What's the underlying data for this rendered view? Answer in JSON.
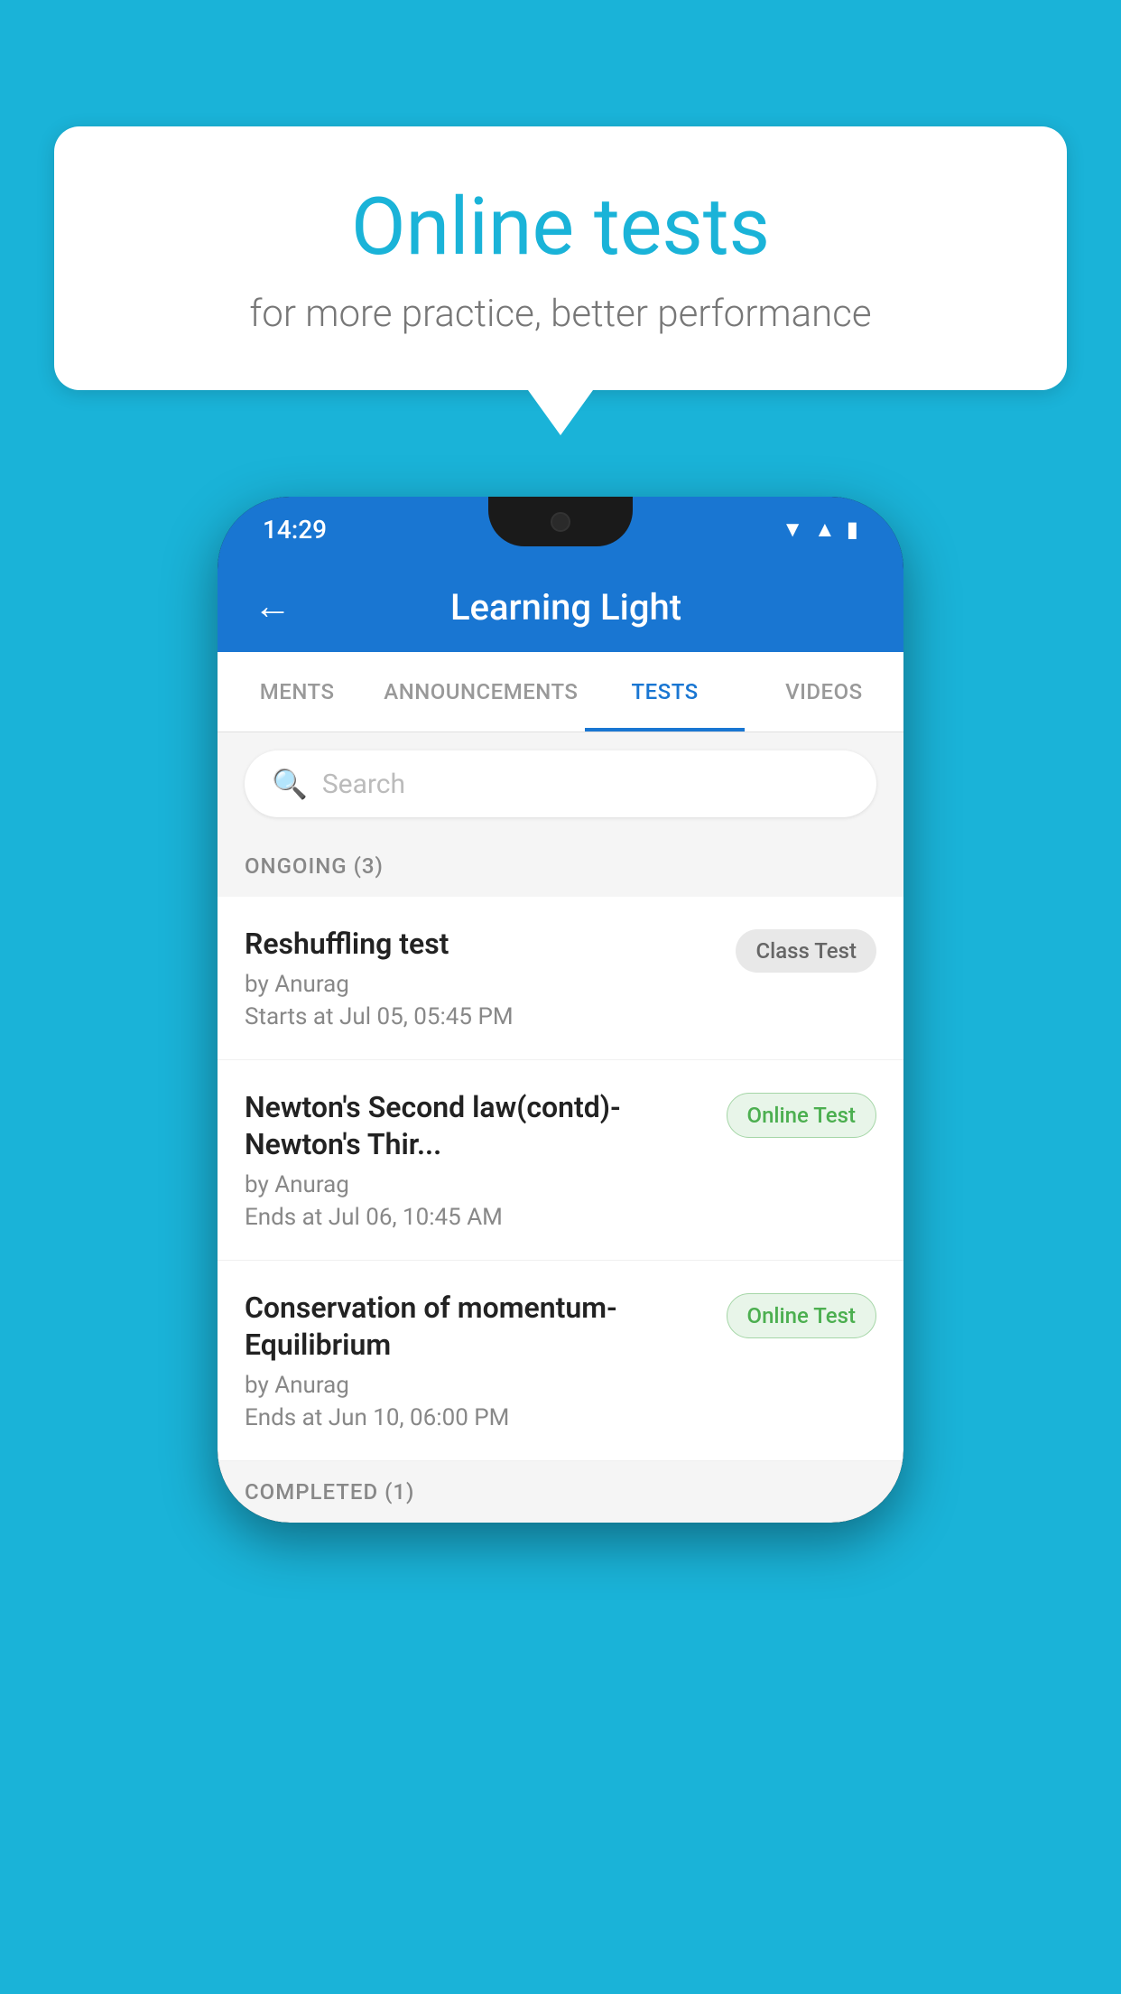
{
  "background": {
    "color": "#1ab3d8"
  },
  "speech_bubble": {
    "title": "Online tests",
    "subtitle": "for more practice, better performance"
  },
  "status_bar": {
    "time": "14:29",
    "icons": [
      "wifi",
      "signal",
      "battery"
    ]
  },
  "app_header": {
    "back_label": "←",
    "title": "Learning Light"
  },
  "tabs": [
    {
      "label": "MENTS",
      "active": false
    },
    {
      "label": "ANNOUNCEMENTS",
      "active": false
    },
    {
      "label": "TESTS",
      "active": true
    },
    {
      "label": "VIDEOS",
      "active": false
    }
  ],
  "search": {
    "placeholder": "Search"
  },
  "ongoing_section": {
    "label": "ONGOING (3)"
  },
  "tests": [
    {
      "name": "Reshuffling test",
      "author": "by Anurag",
      "time_label": "Starts at",
      "time_value": "Jul 05, 05:45 PM",
      "badge": "Class Test",
      "badge_type": "class"
    },
    {
      "name": "Newton's Second law(contd)-Newton's Thir...",
      "author": "by Anurag",
      "time_label": "Ends at",
      "time_value": "Jul 06, 10:45 AM",
      "badge": "Online Test",
      "badge_type": "online"
    },
    {
      "name": "Conservation of momentum-Equilibrium",
      "author": "by Anurag",
      "time_label": "Ends at",
      "time_value": "Jun 10, 06:00 PM",
      "badge": "Online Test",
      "badge_type": "online"
    }
  ],
  "completed_section": {
    "label": "COMPLETED (1)"
  }
}
